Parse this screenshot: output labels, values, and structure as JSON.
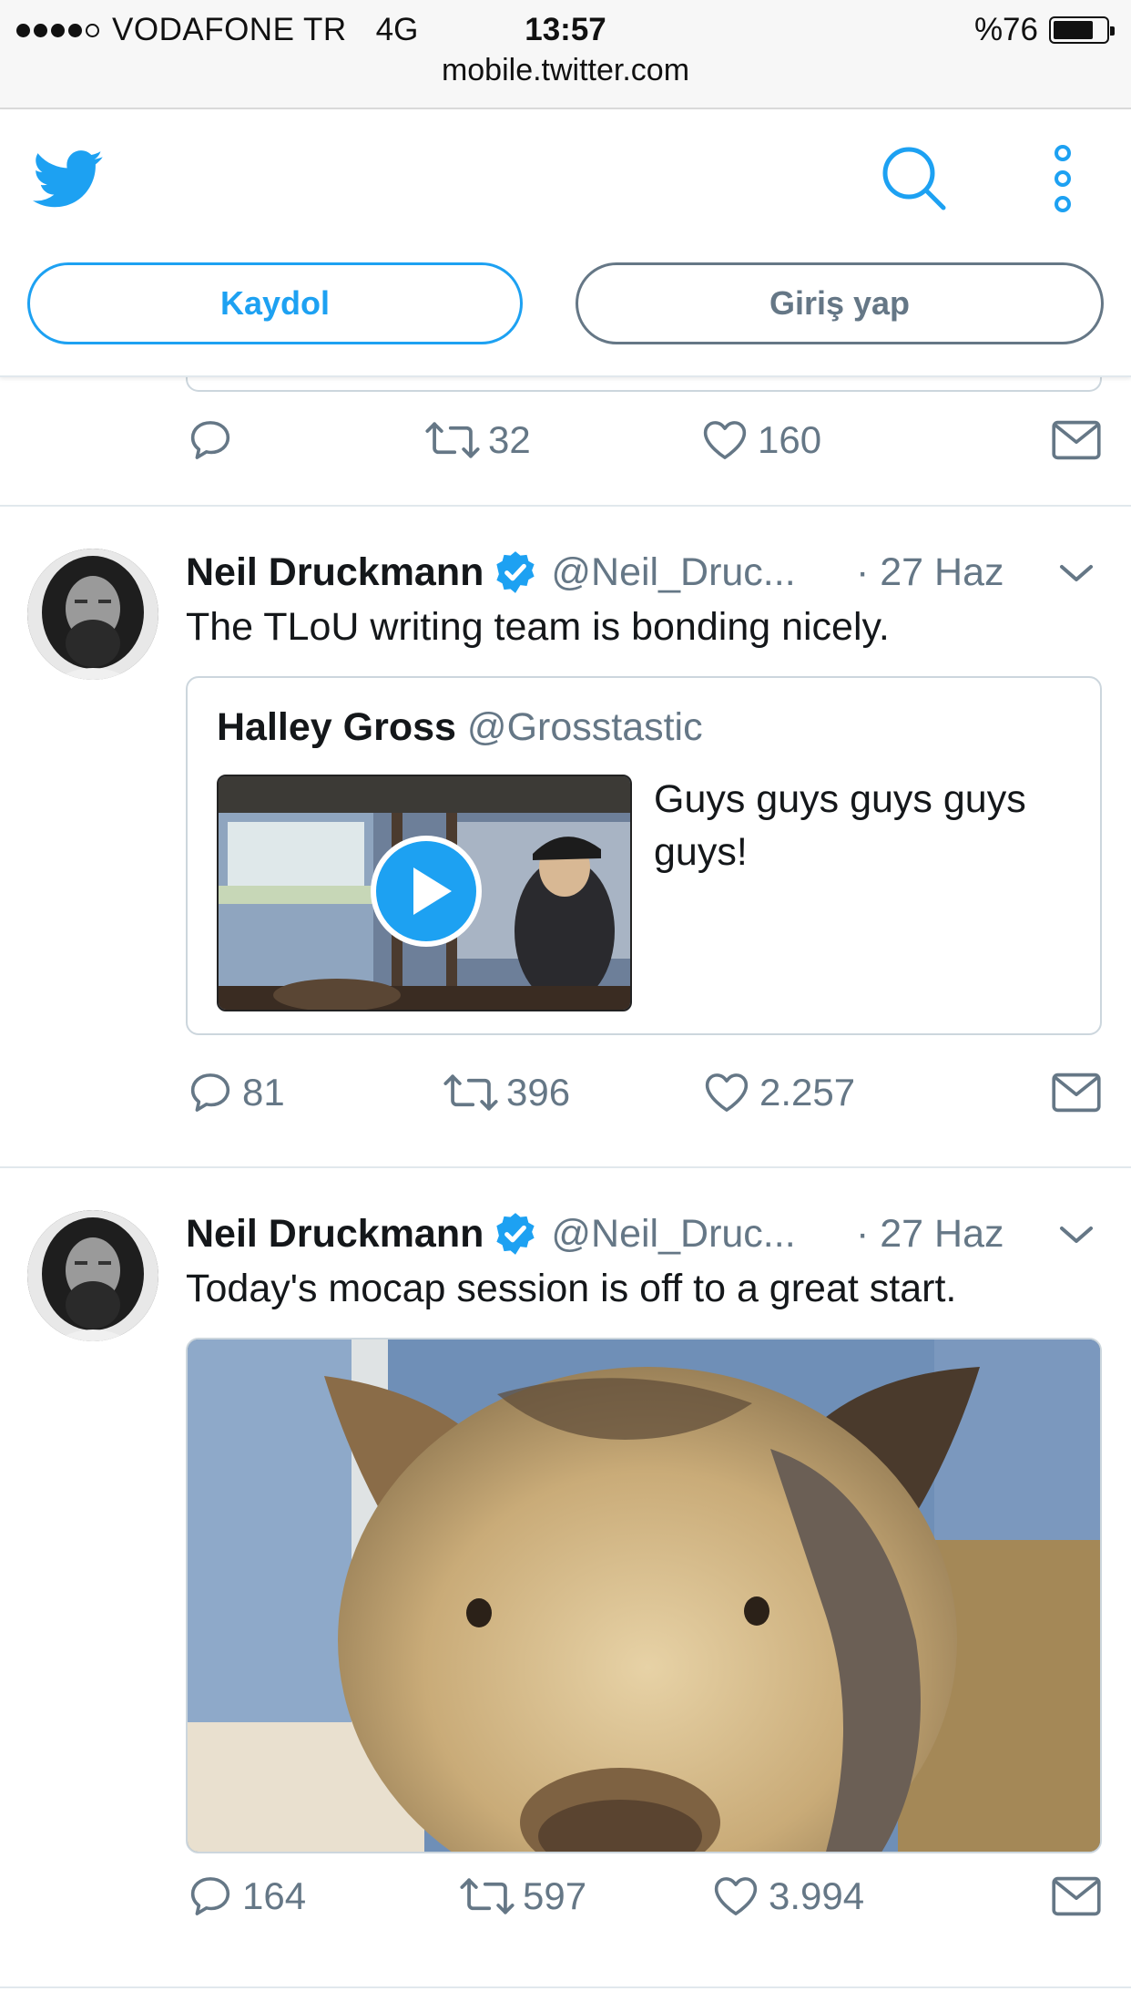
{
  "status_bar": {
    "carrier": "VODAFONE TR",
    "network": "4G",
    "time": "13:57",
    "battery": "%76",
    "battery_level": 0.76,
    "signal_bars_filled": 4,
    "signal_bars_total": 5
  },
  "browser": {
    "url": "mobile.twitter.com"
  },
  "header": {
    "logo_icon": "twitter-bird-icon",
    "search_icon": "search-icon",
    "more_icon": "vertical-dots-icon",
    "signup_label": "Kaydol",
    "login_label": "Giriş yap"
  },
  "colors": {
    "brand_blue": "#1da1f2",
    "muted_gray": "#657786",
    "border": "#e1e8ed"
  },
  "partial_tweet": {
    "actions": {
      "reply": "",
      "retweet": "32",
      "like": "160"
    }
  },
  "tweets": [
    {
      "name": "Neil Druckmann",
      "handle": "@Neil_Druc...",
      "date": "· 27 Haz",
      "verified": true,
      "text": "The TLoU writing team is bonding nicely.",
      "quote": {
        "name": "Halley Gross",
        "handle": "@Grosstastic",
        "text_line1": "Guys guys guys guys",
        "text_line2": "guys!",
        "media": "video"
      },
      "actions": {
        "reply": "81",
        "retweet": "396",
        "like": "2.257"
      }
    },
    {
      "name": "Neil Druckmann",
      "handle": "@Neil_Druc...",
      "date": "· 27 Haz",
      "verified": true,
      "text": "Today's mocap session is off to a great start.",
      "media": "photo",
      "actions": {
        "reply": "164",
        "retweet": "597",
        "like": "3.994"
      }
    }
  ]
}
